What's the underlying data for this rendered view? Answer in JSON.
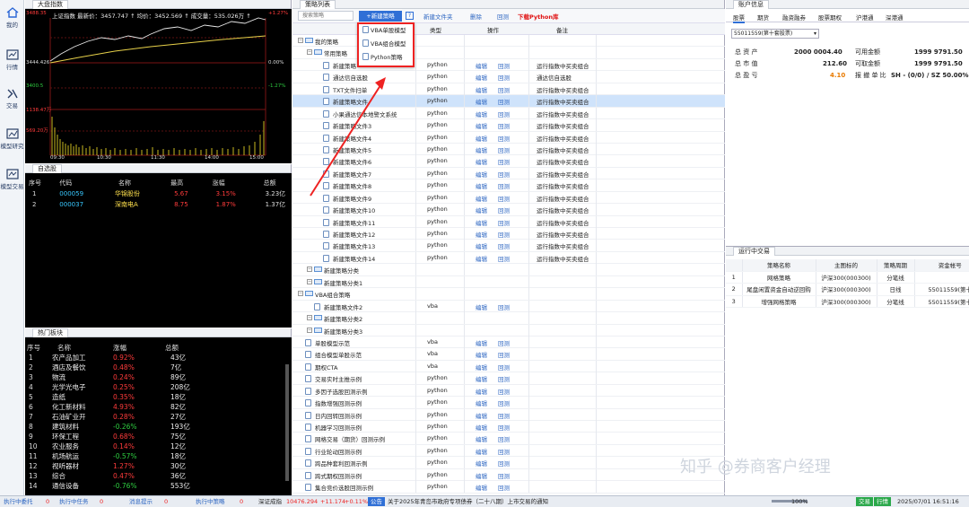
{
  "nav": {
    "items": [
      {
        "label": "我的",
        "icon": "home-icon"
      },
      {
        "label": "行情",
        "icon": "chart-icon"
      },
      {
        "label": "交易",
        "icon": "trade-icon"
      },
      {
        "label": "模型研究",
        "icon": "research-icon"
      },
      {
        "label": "模型交易",
        "icon": "model-trade-icon"
      }
    ]
  },
  "market_index": {
    "tab": "大盘指数",
    "info": "上证指数  最新价：3457.747 ↑  均价：3452.569 ↑  成交量：535.026万 ↑",
    "y_labels_left": [
      "3488.35",
      "3444.426",
      "3400.5"
    ],
    "y_labels_left2": [
      "1138.47万",
      "569.20万"
    ],
    "y_labels_right": [
      "+1.27%",
      "0.00%",
      "-1.27%"
    ],
    "times": [
      "09:30",
      "10:30",
      "11:30",
      "14:00",
      "15:00"
    ]
  },
  "watchlist": {
    "tab": "自选股",
    "headers": [
      "序号",
      "代码",
      "名称",
      "最高",
      "涨幅",
      "总额"
    ],
    "rows": [
      [
        "1",
        "000059",
        "华锦股份",
        "5.67",
        "3.15%",
        "3.23亿"
      ],
      [
        "2",
        "000037",
        "深南电A",
        "8.75",
        "1.87%",
        "1.37亿"
      ]
    ]
  },
  "hot": {
    "tab": "热门板块",
    "headers": [
      "序号",
      "名称",
      "涨幅",
      "总额"
    ],
    "rows": [
      [
        "1",
        "农产品加工",
        "0.92%",
        "43亿"
      ],
      [
        "2",
        "酒店及餐饮",
        "0.48%",
        "7亿"
      ],
      [
        "3",
        "物流",
        "0.24%",
        "89亿"
      ],
      [
        "4",
        "光学光电子",
        "0.25%",
        "208亿"
      ],
      [
        "5",
        "造纸",
        "0.35%",
        "18亿"
      ],
      [
        "6",
        "化工新材料",
        "4.93%",
        "82亿"
      ],
      [
        "7",
        "石油矿业开",
        "0.28%",
        "27亿"
      ],
      [
        "8",
        "建筑材料",
        "-0.26%",
        "193亿"
      ],
      [
        "9",
        "环保工程",
        "0.68%",
        "75亿"
      ],
      [
        "10",
        "农业服务",
        "0.14%",
        "12亿"
      ],
      [
        "11",
        "机场航运",
        "-0.57%",
        "18亿"
      ],
      [
        "12",
        "视听器材",
        "1.27%",
        "30亿"
      ],
      [
        "13",
        "综合",
        "0.47%",
        "36亿"
      ],
      [
        "14",
        "通信设备",
        "-0.76%",
        "553亿"
      ]
    ]
  },
  "strategy": {
    "tab": "策略列表",
    "search_placeholder": "搜索策略",
    "new_btn": "+新建策略",
    "help": "?",
    "new_folder": "新建文件夹",
    "delete": "删除",
    "backtest": "回测",
    "download": "下载Python库",
    "col_type": "类型",
    "col_op": "操作",
    "col_note": "备注",
    "dropdown": [
      "VBA单股模型",
      "VBA组合模型",
      "Python策略"
    ],
    "rows": [
      {
        "ind": 1,
        "kind": "folder",
        "name": "我的策略",
        "type": "",
        "edit": "",
        "bt": "",
        "note": ""
      },
      {
        "ind": 2,
        "kind": "folder",
        "name": "常用策略",
        "type": "",
        "edit": "",
        "bt": "",
        "note": ""
      },
      {
        "ind": 3,
        "kind": "file",
        "name": "新建策略",
        "type": "python",
        "edit": "编辑",
        "bt": "回测",
        "note": "运行指数中买卖组合"
      },
      {
        "ind": 3,
        "kind": "file",
        "name": "通达信自选股",
        "type": "python",
        "edit": "编辑",
        "bt": "回测",
        "note": "通达信自选股"
      },
      {
        "ind": 3,
        "kind": "file",
        "name": "TXT文件扫单",
        "type": "python",
        "edit": "编辑",
        "bt": "回测",
        "note": "运行指数中买卖组合"
      },
      {
        "ind": 3,
        "kind": "file",
        "name": "新建策略文件",
        "type": "python",
        "edit": "编辑",
        "bt": "回测",
        "note": "运行指数中买卖组合",
        "sel": true
      },
      {
        "ind": 3,
        "kind": "file",
        "name": "小果通达信本地警文系统",
        "type": "python",
        "edit": "编辑",
        "bt": "回测",
        "note": "运行指数中买卖组合"
      },
      {
        "ind": 3,
        "kind": "file",
        "name": "新建策略文件3",
        "type": "python",
        "edit": "编辑",
        "bt": "回测",
        "note": "运行指数中买卖组合"
      },
      {
        "ind": 3,
        "kind": "file",
        "name": "新建策略文件4",
        "type": "python",
        "edit": "编辑",
        "bt": "回测",
        "note": "运行指数中买卖组合"
      },
      {
        "ind": 3,
        "kind": "file",
        "name": "新建策略文件5",
        "type": "python",
        "edit": "编辑",
        "bt": "回测",
        "note": "运行指数中买卖组合"
      },
      {
        "ind": 3,
        "kind": "file",
        "name": "新建策略文件6",
        "type": "python",
        "edit": "编辑",
        "bt": "回测",
        "note": "运行指数中买卖组合"
      },
      {
        "ind": 3,
        "kind": "file",
        "name": "新建策略文件7",
        "type": "python",
        "edit": "编辑",
        "bt": "回测",
        "note": "运行指数中买卖组合"
      },
      {
        "ind": 3,
        "kind": "file",
        "name": "新建策略文件8",
        "type": "python",
        "edit": "编辑",
        "bt": "回测",
        "note": "运行指数中买卖组合"
      },
      {
        "ind": 3,
        "kind": "file",
        "name": "新建策略文件9",
        "type": "python",
        "edit": "编辑",
        "bt": "回测",
        "note": "运行指数中买卖组合"
      },
      {
        "ind": 3,
        "kind": "file",
        "name": "新建策略文件10",
        "type": "python",
        "edit": "编辑",
        "bt": "回测",
        "note": "运行指数中买卖组合"
      },
      {
        "ind": 3,
        "kind": "file",
        "name": "新建策略文件11",
        "type": "python",
        "edit": "编辑",
        "bt": "回测",
        "note": "运行指数中买卖组合"
      },
      {
        "ind": 3,
        "kind": "file",
        "name": "新建策略文件12",
        "type": "python",
        "edit": "编辑",
        "bt": "回测",
        "note": "运行指数中买卖组合"
      },
      {
        "ind": 3,
        "kind": "file",
        "name": "新建策略文件13",
        "type": "python",
        "edit": "编辑",
        "bt": "回测",
        "note": "运行指数中买卖组合"
      },
      {
        "ind": 3,
        "kind": "file",
        "name": "新建策略文件14",
        "type": "python",
        "edit": "编辑",
        "bt": "回测",
        "note": "运行指数中买卖组合"
      },
      {
        "ind": 2,
        "kind": "folder",
        "name": "新建策略分类",
        "type": "",
        "edit": "",
        "bt": "",
        "note": ""
      },
      {
        "ind": 2,
        "kind": "folder",
        "name": "新建策略分类1",
        "type": "",
        "edit": "",
        "bt": "",
        "note": ""
      },
      {
        "ind": 1,
        "kind": "folder",
        "name": "VBA组合策略",
        "type": "",
        "edit": "",
        "bt": "",
        "note": ""
      },
      {
        "ind": 2,
        "kind": "file",
        "name": "新建策略文件2",
        "type": "vba",
        "edit": "编辑",
        "bt": "回测",
        "note": ""
      },
      {
        "ind": 2,
        "kind": "folder",
        "name": "新建策略分类2",
        "type": "",
        "edit": "",
        "bt": "",
        "note": ""
      },
      {
        "ind": 2,
        "kind": "folder",
        "name": "新建策略分类3",
        "type": "",
        "edit": "",
        "bt": "",
        "note": ""
      },
      {
        "ind": 1,
        "kind": "file",
        "name": "单股模型示范",
        "type": "vba",
        "edit": "编辑",
        "bt": "回测",
        "note": ""
      },
      {
        "ind": 1,
        "kind": "file",
        "name": "组合模型单股示范",
        "type": "vba",
        "edit": "编辑",
        "bt": "回测",
        "note": ""
      },
      {
        "ind": 1,
        "kind": "file",
        "name": "期权CTA",
        "type": "vba",
        "edit": "编辑",
        "bt": "回测",
        "note": ""
      },
      {
        "ind": 1,
        "kind": "file",
        "name": "交易实时主推示例",
        "type": "python",
        "edit": "编辑",
        "bt": "回测",
        "note": ""
      },
      {
        "ind": 1,
        "kind": "file",
        "name": "多因子选股回测示例",
        "type": "python",
        "edit": "编辑",
        "bt": "回测",
        "note": ""
      },
      {
        "ind": 1,
        "kind": "file",
        "name": "指数增强回测示例",
        "type": "python",
        "edit": "编辑",
        "bt": "回测",
        "note": ""
      },
      {
        "ind": 1,
        "kind": "file",
        "name": "日内回转回测示例",
        "type": "python",
        "edit": "编辑",
        "bt": "回测",
        "note": ""
      },
      {
        "ind": 1,
        "kind": "file",
        "name": "机器学习回测示例",
        "type": "python",
        "edit": "编辑",
        "bt": "回测",
        "note": ""
      },
      {
        "ind": 1,
        "kind": "file",
        "name": "网格交易（期货）回测示例",
        "type": "python",
        "edit": "编辑",
        "bt": "回测",
        "note": ""
      },
      {
        "ind": 1,
        "kind": "file",
        "name": "行业轮动回测示例",
        "type": "python",
        "edit": "编辑",
        "bt": "回测",
        "note": ""
      },
      {
        "ind": 1,
        "kind": "file",
        "name": "跨品种套利回测示例",
        "type": "python",
        "edit": "编辑",
        "bt": "回测",
        "note": ""
      },
      {
        "ind": 1,
        "kind": "file",
        "name": "跨式期权回测示例",
        "type": "python",
        "edit": "编辑",
        "bt": "回测",
        "note": ""
      },
      {
        "ind": 1,
        "kind": "file",
        "name": "集合竞价选股回测示例",
        "type": "python",
        "edit": "编辑",
        "bt": "回测",
        "note": ""
      }
    ]
  },
  "account": {
    "tab": "账户信息",
    "tabs": [
      "股票",
      "期货",
      "融资融券",
      "股票期权",
      "沪港通",
      "深港通"
    ],
    "select": "55011559(第十套股票)",
    "r1": [
      "总 资 产",
      "2000 0004.40",
      "可用金额",
      "1999 9791.50"
    ],
    "r2": [
      "总 市 值",
      "212.60",
      "可取金额",
      "1999 9791.50"
    ],
    "r3": [
      "总 盈 亏",
      "4.10",
      "报 撤 单 比",
      "SH - (0/0) / SZ 50.00% (1/2)"
    ]
  },
  "running": {
    "tab": "运行中交易",
    "headers": [
      "",
      "策略名称",
      "主图标的",
      "策略周期",
      "资金帐号"
    ],
    "rows": [
      [
        "1",
        "网格策略",
        "沪深300(000300)",
        "分笔线",
        ""
      ],
      [
        "2",
        "尾盘闲置资金自动逆回购",
        "沪深300(000300)",
        "日线",
        "55011559(第十"
      ],
      [
        "3",
        "增强网格策略",
        "沪深300(000300)",
        "分笔线",
        "55011559(第十"
      ]
    ]
  },
  "status": {
    "items": [
      "执行中委托",
      "0",
      "执行中任务",
      "0",
      "消息提示",
      "0",
      "执行中策略",
      "0"
    ],
    "index_name": "深证成指",
    "index_val": "10476.294",
    "index_chg": "+11.174",
    "index_pct": "+0.11%",
    "notice_tag": "公告",
    "notice": "关于2025年青岛市政府专项债券（二十八期）上市交易的通知",
    "zoom": "100%",
    "btn1": "交易",
    "btn2": "行情",
    "datetime": "2025/07/01 16:51:16"
  },
  "watermark": "知乎 @券商客户经理"
}
